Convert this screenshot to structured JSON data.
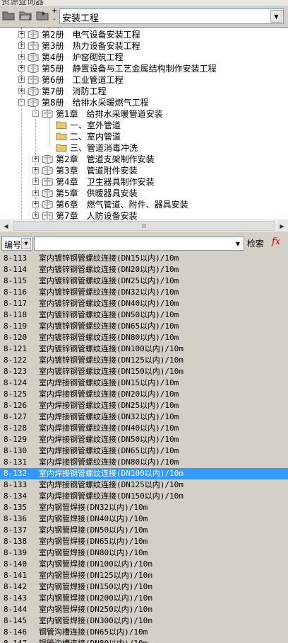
{
  "window": {
    "title": "资源查询器"
  },
  "toolbar": {
    "expand_glyph": "+",
    "collapse_glyph": "-",
    "library": "安装工程"
  },
  "tree": [
    {
      "level": 1,
      "expander": "+",
      "label": "第2册　电气设备安装工程"
    },
    {
      "level": 1,
      "expander": "+",
      "label": "第3册　热力设备安装工程"
    },
    {
      "level": 1,
      "expander": "+",
      "label": "第4册　炉窑砌筑工程"
    },
    {
      "level": 1,
      "expander": "+",
      "label": "第5册　静置设备与工艺金属结构制作安装工程"
    },
    {
      "level": 1,
      "expander": "+",
      "label": "第6册　工业管道工程"
    },
    {
      "level": 1,
      "expander": "+",
      "label": "第7册　消防工程"
    },
    {
      "level": 1,
      "expander": "-",
      "label": "第8册　给排水采暖燃气工程"
    },
    {
      "level": 2,
      "expander": "-",
      "label": "第1章　给排水采暖管道安装"
    },
    {
      "level": 3,
      "expander": "",
      "label": "一、室外管道"
    },
    {
      "level": 3,
      "expander": "",
      "label": "二、室内管道"
    },
    {
      "level": 3,
      "expander": "",
      "label": "三、管道消毒冲洗"
    },
    {
      "level": 2,
      "expander": "+",
      "label": "第2章　管道支架制作安装"
    },
    {
      "level": 2,
      "expander": "+",
      "label": "第3章　管道附件安装"
    },
    {
      "level": 2,
      "expander": "+",
      "label": "第4章　卫生器具制作安装"
    },
    {
      "level": 2,
      "expander": "+",
      "label": "第5章　供暖器具安装"
    },
    {
      "level": 2,
      "expander": "+",
      "label": "第6章　燃气管道、附件、器具安装"
    },
    {
      "level": 2,
      "expander": "+",
      "label": "第7章　人防设备安装"
    }
  ],
  "hscroll": {
    "left": "◀",
    "right": "▶",
    "grip": "III"
  },
  "search": {
    "field": "编号",
    "field_arrow": "▼",
    "input_arrow": "▼",
    "button": "检索",
    "fx": "fx"
  },
  "list": {
    "selected_index": 19,
    "rows": [
      {
        "code": "8-113",
        "name": "室内镀锌钢管螺纹连接(DN15以内)/10m"
      },
      {
        "code": "8-114",
        "name": "室内镀锌钢管螺纹连接(DN20以内)/10m"
      },
      {
        "code": "8-115",
        "name": "室内镀锌钢管螺纹连接(DN25以内)/10m"
      },
      {
        "code": "8-116",
        "name": "室内镀锌钢管螺纹连接(DN32以内)/10m"
      },
      {
        "code": "8-117",
        "name": "室内镀锌钢管螺纹连接(DN40以内)/10m"
      },
      {
        "code": "8-118",
        "name": "室内镀锌钢管螺纹连接(DN50以内)/10m"
      },
      {
        "code": "8-119",
        "name": "室内镀锌钢管螺纹连接(DN65以内)/10m"
      },
      {
        "code": "8-120",
        "name": "室内镀锌钢管螺纹连接(DN80以内)/10m"
      },
      {
        "code": "8-121",
        "name": "室内镀锌钢管螺纹连接(DN100以内)/10m"
      },
      {
        "code": "8-122",
        "name": "室内镀锌钢管螺纹连接(DN125以内)/10m"
      },
      {
        "code": "8-123",
        "name": "室内镀锌钢管螺纹连接(DN150以内)/10m"
      },
      {
        "code": "8-124",
        "name": "室内焊接钢管螺纹连接(DN15以内)/10m"
      },
      {
        "code": "8-125",
        "name": "室内焊接钢管螺纹连接(DN20以内)/10m"
      },
      {
        "code": "8-126",
        "name": "室内焊接钢管螺纹连接(DN25以内)/10m"
      },
      {
        "code": "8-127",
        "name": "室内焊接钢管螺纹连接(DN32以内)/10m"
      },
      {
        "code": "8-128",
        "name": "室内焊接钢管螺纹连接(DN40以内)/10m"
      },
      {
        "code": "8-129",
        "name": "室内焊接钢管螺纹连接(DN50以内)/10m"
      },
      {
        "code": "8-130",
        "name": "室内焊接钢管螺纹连接(DN65以内)/10m"
      },
      {
        "code": "8-131",
        "name": "室内焊接钢管螺纹连接(DN80以内)/10m"
      },
      {
        "code": "8-132",
        "name": "室内焊接钢管螺纹连接(DN100以内)/10m"
      },
      {
        "code": "8-133",
        "name": "室内焊接钢管螺纹连接(DN125以内)/10m"
      },
      {
        "code": "8-134",
        "name": "室内焊接钢管螺纹连接(DN150以内)/10m"
      },
      {
        "code": "8-135",
        "name": "室内钢管焊接(DN32以内)/10m"
      },
      {
        "code": "8-136",
        "name": "室内钢管焊接(DN40以内)/10m"
      },
      {
        "code": "8-137",
        "name": "室内钢管焊接(DN50以内)/10m"
      },
      {
        "code": "8-138",
        "name": "室内钢管焊接(DN65以内)/10m"
      },
      {
        "code": "8-139",
        "name": "室内钢管焊接(DN80以内)/10m"
      },
      {
        "code": "8-140",
        "name": "室内钢管焊接(DN100以内)/10m"
      },
      {
        "code": "8-141",
        "name": "室内钢管焊接(DN125以内)/10m"
      },
      {
        "code": "8-142",
        "name": "室内钢管焊接(DN150以内)/10m"
      },
      {
        "code": "8-143",
        "name": "室内钢管焊接(DN200以内)/10m"
      },
      {
        "code": "8-144",
        "name": "室内钢管焊接(DN250以内)/10m"
      },
      {
        "code": "8-145",
        "name": "室内钢管焊接(DN300以内)/10m"
      },
      {
        "code": "8-146",
        "name": "钢管沟槽连接(DN65以内)/10m"
      },
      {
        "code": "8-147",
        "name": "钢管沟槽连接(DN80以内)/10m"
      }
    ]
  },
  "colors": {
    "selection": "#3399ff",
    "panel": "#d4d0c8",
    "folder": "#e8c870"
  }
}
